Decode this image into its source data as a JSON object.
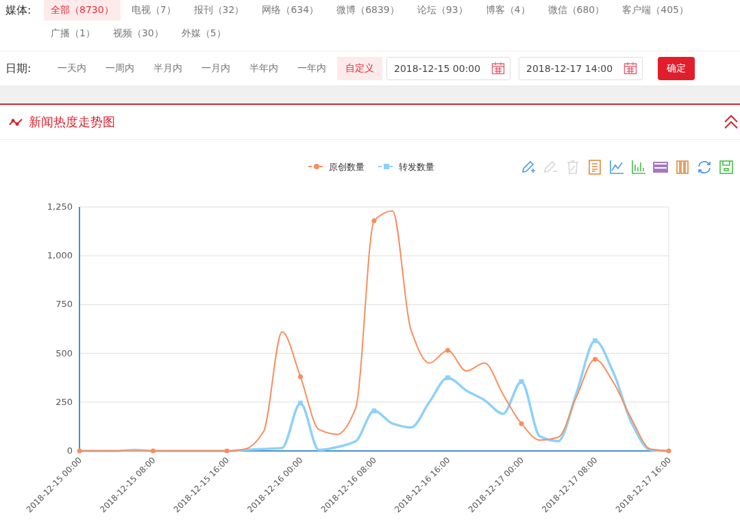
{
  "media_filter": {
    "label": "媒体:",
    "options": [
      {
        "text": "全部（8730）",
        "selected": true
      },
      {
        "text": "电视（7）",
        "selected": false
      },
      {
        "text": "报刊（32）",
        "selected": false
      },
      {
        "text": "网络（634）",
        "selected": false
      },
      {
        "text": "微博（6839）",
        "selected": false
      },
      {
        "text": "论坛（93）",
        "selected": false
      },
      {
        "text": "博客（4）",
        "selected": false
      },
      {
        "text": "微信（680）",
        "selected": false
      },
      {
        "text": "客户端（405）",
        "selected": false
      },
      {
        "text": "广播（1）",
        "selected": false
      },
      {
        "text": "视频（30）",
        "selected": false
      },
      {
        "text": "外媒（5）",
        "selected": false
      }
    ]
  },
  "date_filter": {
    "label": "日期:",
    "options": [
      {
        "text": "一天内",
        "selected": false
      },
      {
        "text": "一周内",
        "selected": false
      },
      {
        "text": "半月内",
        "selected": false
      },
      {
        "text": "一月内",
        "selected": false
      },
      {
        "text": "半年内",
        "selected": false
      },
      {
        "text": "一年内",
        "selected": false
      },
      {
        "text": "自定义",
        "selected": true
      }
    ],
    "start": "2018-12-15 00:00",
    "end": "2018-12-17 14:00",
    "confirm": "确定"
  },
  "panel": {
    "title": "新闻热度走势图",
    "toolbox": [
      {
        "kind": "zoom",
        "disabled": false
      },
      {
        "kind": "zoom_back",
        "disabled": true
      },
      {
        "kind": "clear",
        "disabled": true
      },
      {
        "kind": "data_view",
        "disabled": false
      },
      {
        "kind": "line",
        "disabled": false
      },
      {
        "kind": "bar",
        "disabled": false
      },
      {
        "kind": "stack",
        "disabled": false
      },
      {
        "kind": "tiled",
        "disabled": false
      },
      {
        "kind": "restore",
        "disabled": false
      },
      {
        "kind": "save",
        "disabled": false
      }
    ],
    "chart_data": {
      "type": "line",
      "categories": [
        "2018-12-15 00:00",
        null,
        null,
        null,
        "2018-12-15 08:00",
        null,
        null,
        null,
        "2018-12-15 16:00",
        null,
        null,
        null,
        "2018-12-16 00:00",
        null,
        null,
        null,
        "2018-12-16 08:00",
        null,
        null,
        null,
        "2018-12-16 16:00",
        null,
        null,
        null,
        "2018-12-17 00:00",
        null,
        null,
        null,
        "2018-12-17 08:00",
        null,
        null,
        null,
        "2018-12-17 16:00"
      ],
      "series": [
        {
          "name": "原创数量",
          "color": "#f98d5e",
          "values": [
            0,
            0,
            0,
            0,
            0,
            0,
            0,
            0,
            0,
            10,
            100,
            610,
            380,
            110,
            85,
            220,
            1180,
            1230,
            620,
            450,
            515,
            410,
            450,
            290,
            140,
            55,
            70,
            280,
            470,
            350,
            160,
            10,
            0
          ]
        },
        {
          "name": "转发数量",
          "color": "#8dd1f8",
          "values": [
            0,
            0,
            0,
            5,
            0,
            0,
            0,
            0,
            0,
            5,
            10,
            15,
            245,
            5,
            20,
            50,
            205,
            140,
            120,
            250,
            375,
            310,
            260,
            190,
            355,
            75,
            50,
            300,
            565,
            400,
            140,
            5,
            0
          ]
        }
      ],
      "ylim": [
        0,
        1250
      ],
      "grid": true,
      "legend": true,
      "yticks": [
        {
          "value": 0,
          "label": "0"
        },
        {
          "value": 250,
          "label": "250"
        },
        {
          "value": 500,
          "label": "500"
        },
        {
          "value": 750,
          "label": "750"
        },
        {
          "value": 1000,
          "label": "1,000"
        },
        {
          "value": 1250,
          "label": "1,250"
        }
      ]
    }
  }
}
